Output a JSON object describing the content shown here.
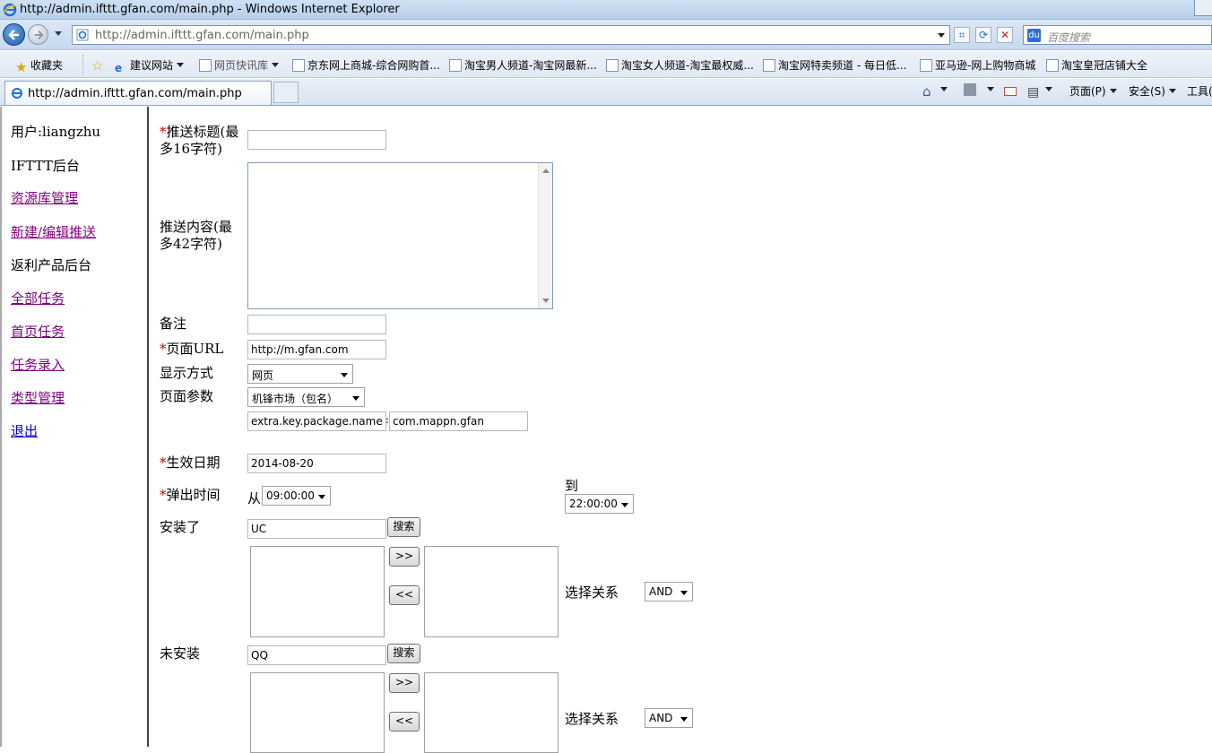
{
  "window": {
    "title": "http://admin.ifttt.gfan.com/main.php - Windows Internet Explorer"
  },
  "address_bar": {
    "url": "http://admin.ifttt.gfan.com/main.php",
    "search_placeholder": "百度搜索"
  },
  "favorites_bar": {
    "favorites_label": "收藏夹",
    "items": [
      "建议网站",
      "网页快讯库",
      "京东网上商城-综合网购首...",
      "淘宝男人频道-淘宝网最新...",
      "淘宝女人频道-淘宝最权威...",
      "淘宝网特卖频道 - 每日低...",
      "亚马逊-网上购物商城",
      "淘宝皇冠店铺大全"
    ]
  },
  "tabs": {
    "active_tab": "http://admin.ifttt.gfan.com/main.php",
    "commands": {
      "page": "页面(P)",
      "safety": "安全(S)",
      "tools": "工具("
    }
  },
  "sidebar": {
    "user": "用户:liangzhu",
    "section1": "IFTTT后台",
    "link_resources": "资源库管理",
    "link_new_push": "新建/编辑推送",
    "section2": "返利产品后台",
    "link_all_tasks": "全部任务",
    "link_home_tasks": "首页任务",
    "link_task_entry": "任务录入",
    "link_type_mgmt": "类型管理",
    "link_logout": "退出"
  },
  "form": {
    "required_mark": "*",
    "push_title_label_1": "推送标题(最",
    "push_title_label_2": "多16字符)",
    "push_title_value": "",
    "push_content_label_1": "推送内容(最",
    "push_content_label_2": "多42字符)",
    "note_label": "备注",
    "note_value": "",
    "page_url_label": "页面URL",
    "page_url_value": "http://m.gfan.com",
    "display_mode_label": "显示方式",
    "display_mode_value": "网页",
    "page_param_label": "页面参数",
    "page_param_value": "机锋市场（包名）",
    "param_key": "extra.key.package.name",
    "param_separator": ":",
    "param_value": "com.mappn.gfan",
    "effective_date_label": "生效日期",
    "effective_date_value": "2014-08-20",
    "popup_time_label": "弹出时间",
    "from_label": "从",
    "from_time": "09:00:00",
    "to_label": "到",
    "to_time": "22:00:00",
    "installed_label": "安装了",
    "installed_search_value": "UC",
    "search_button": "搜索",
    "move_right_button": ">>",
    "move_left_button": "<<",
    "relation_label": "选择关系",
    "relation_value_1": "AND",
    "not_installed_label": "未安装",
    "not_installed_search_value": "QQ",
    "relation_value_2": "AND"
  }
}
